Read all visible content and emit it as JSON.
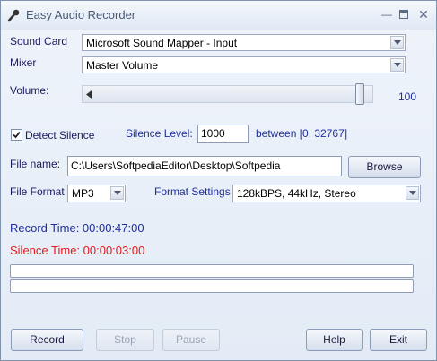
{
  "window": {
    "title": "Easy Audio Recorder"
  },
  "labels": {
    "sound_card": "Sound Card",
    "mixer": "Mixer",
    "volume": "Volume:",
    "detect_silence": "Detect Silence",
    "silence_level": "Silence Level:",
    "between": "between [0, 32767]",
    "file_name": "File name:",
    "file_format": "File Format",
    "format_settings": "Format Settings"
  },
  "fields": {
    "sound_card": "Microsoft Sound Mapper - Input",
    "mixer": "Master Volume",
    "volume_value": "100",
    "volume_fraction": 1.0,
    "detect_silence_checked": true,
    "silence_level": "1000",
    "file_name": "C:\\Users\\SoftpediaEditor\\Desktop\\Softpedia",
    "file_format": "MP3",
    "format_settings": "128kBPS, 44kHz, Stereo"
  },
  "status": {
    "record_time": "Record Time: 00:00:47:00",
    "silence_time": "Silence Time: 00:00:03:00"
  },
  "buttons": {
    "browse": "Browse",
    "record": "Record",
    "stop": "Stop",
    "pause": "Pause",
    "help": "Help",
    "exit": "Exit"
  },
  "colors": {
    "record_time": "#1f2f9a",
    "silence_time": "#e21b1b"
  }
}
